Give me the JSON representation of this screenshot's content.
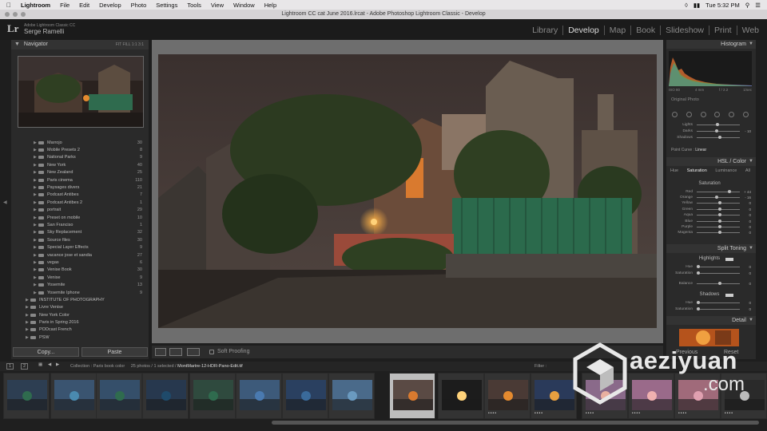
{
  "menubar": {
    "app": "Lightroom",
    "items": [
      "File",
      "Edit",
      "Develop",
      "Photo",
      "Settings",
      "Tools",
      "View",
      "Window",
      "Help"
    ],
    "clock": "Tue 5:32 PM"
  },
  "window": {
    "title": "Lightroom CC cat June 2016.lrcat - Adobe Photoshop Lightroom Classic - Develop"
  },
  "identity": {
    "logo": "Lr",
    "product": "Adobe Lightroom Classic CC",
    "owner": "Serge Ramelli"
  },
  "modules": [
    "Library",
    "Develop",
    "Map",
    "Book",
    "Slideshow",
    "Print",
    "Web"
  ],
  "active_module": "Develop",
  "navigator": {
    "title": "Navigator",
    "options": "FIT  FILL  1:1  3:1"
  },
  "folders": [
    {
      "name": "Marrojo",
      "count": "30"
    },
    {
      "name": "Mobile Presets 2",
      "count": "8"
    },
    {
      "name": "National Parks",
      "count": "9"
    },
    {
      "name": "New York",
      "count": "40"
    },
    {
      "name": "New Zealand",
      "count": "25"
    },
    {
      "name": "Paris cinema",
      "count": "110"
    },
    {
      "name": "Paysages divers",
      "count": "21"
    },
    {
      "name": "Podcast Antibes",
      "count": "7"
    },
    {
      "name": "Podcast Antibes 2",
      "count": "1"
    },
    {
      "name": "portrait",
      "count": "29"
    },
    {
      "name": "Preset on mobile",
      "count": "10"
    },
    {
      "name": "San Franciso",
      "count": "1"
    },
    {
      "name": "Sky Replacement",
      "count": "32"
    },
    {
      "name": "Source files",
      "count": "30"
    },
    {
      "name": "Special Layer Effects",
      "count": "9"
    },
    {
      "name": "vacance jose et sandia",
      "count": "27"
    },
    {
      "name": "vegas",
      "count": "6"
    },
    {
      "name": "Venise Book",
      "count": "30"
    },
    {
      "name": "Venise",
      "count": "9"
    },
    {
      "name": "Yosemite",
      "count": "13"
    },
    {
      "name": "Yosemite Iphone",
      "count": "9"
    },
    {
      "name": "INSTITUTE OF PHOTOGRAPHY",
      "count": ""
    },
    {
      "name": "Livre Venise",
      "count": ""
    },
    {
      "name": "New York Color",
      "count": ""
    },
    {
      "name": "Paris in Spring 2016",
      "count": ""
    },
    {
      "name": "PODcast French",
      "count": ""
    },
    {
      "name": "PSW",
      "count": ""
    }
  ],
  "buttons": {
    "copy": "Copy...",
    "paste": "Paste"
  },
  "toolbar": {
    "soft_proofing": "Soft Proofing"
  },
  "histogram": {
    "title": "Histogram",
    "info": [
      "ISO 80",
      "4 mm",
      "f / 2.2",
      "1/sec"
    ],
    "original_photo": "Original Photo"
  },
  "tone": {
    "rows": [
      {
        "label": "Lights",
        "value": ""
      },
      {
        "label": "Darks",
        "value": "- 10"
      },
      {
        "label": "Shadows",
        "value": ""
      }
    ],
    "point_curve_label": "Point Curve :",
    "point_curve_value": "Linear"
  },
  "hsl": {
    "title": "HSL / Color",
    "tabs": [
      "Hue",
      "Saturation",
      "Luminance",
      "All"
    ],
    "active_tab": "Saturation",
    "section": "Saturation",
    "rows": [
      {
        "label": "Red",
        "value": "+ 44",
        "pos": 0.72
      },
      {
        "label": "Orange",
        "value": "- 16",
        "pos": 0.42
      },
      {
        "label": "Yellow",
        "value": "0",
        "pos": 0.5
      },
      {
        "label": "Green",
        "value": "0",
        "pos": 0.5
      },
      {
        "label": "Aqua",
        "value": "0",
        "pos": 0.5
      },
      {
        "label": "Blue",
        "value": "0",
        "pos": 0.5
      },
      {
        "label": "Purple",
        "value": "0",
        "pos": 0.5
      },
      {
        "label": "Magenta",
        "value": "0",
        "pos": 0.5
      }
    ]
  },
  "split": {
    "title": "Split Toning",
    "highlights": "Highlights",
    "hue": "Hue",
    "saturation": "Saturation",
    "balance": "Balance",
    "shadows": "Shadows",
    "zero": "0"
  },
  "detail": {
    "title": "Detail"
  },
  "filmstrip": {
    "collection": "Collection : Paris book color",
    "count": "25 photos / 1 selected /",
    "file": "MontMartre-12-HDR-Pano-Edit.tif",
    "filter": "Filter :",
    "pages": [
      "1",
      "2"
    ]
  },
  "watermark": {
    "text": "aeziyuan",
    "suffix": ".com",
    "previous": "Previous",
    "reset": "Reset"
  }
}
